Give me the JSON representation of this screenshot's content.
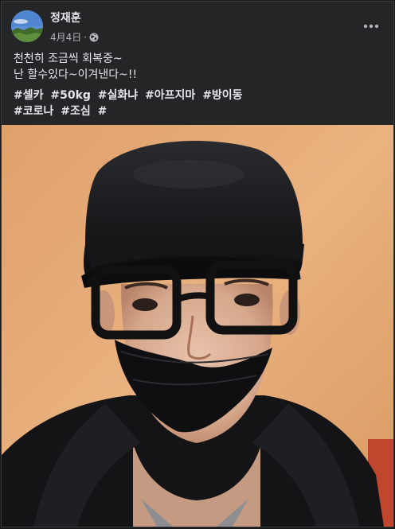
{
  "post": {
    "author": "정재훈",
    "date": "4月4日",
    "separator": "·",
    "privacy_icon": "globe-icon",
    "more_icon": "more-horizontal-icon",
    "text_lines": [
      "천천히 조금씩 회복중~",
      "난 할수있다~이겨낸다~!!"
    ],
    "hashtags_line1": [
      "#셀카",
      "#50kg",
      "#실화냐",
      "#아프지마",
      "#방이동"
    ],
    "hashtags_line2": [
      "#코로나",
      "#조심",
      "#"
    ],
    "photo_subject": "selfie-photo"
  }
}
